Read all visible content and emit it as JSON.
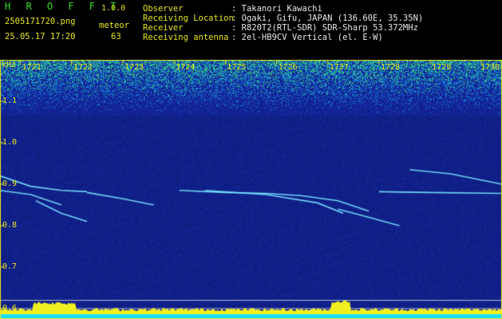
{
  "app": {
    "brand": "H R O F F T",
    "version": "1.0.0"
  },
  "file": {
    "name": "2505171720.png",
    "datetime": "25.05.17 17:20"
  },
  "meteor": {
    "label": "meteor",
    "count": "63"
  },
  "info": [
    {
      "label": "Observer",
      "value": ": Takanori Kawachi"
    },
    {
      "label": "Receiving Location",
      "value": ": Ogaki, Gifu, JAPAN (136.60E, 35.35N)"
    },
    {
      "label": "Receiver",
      "value": ": R820T2(RTL-SDR) SDR-Sharp 53.372MHz"
    },
    {
      "label": "Receiving antenna",
      "value": ": 2el-HB9CV Vertical (el. E-W)"
    }
  ],
  "colors": {
    "brand": "#35e21f",
    "accent": "#e6e619",
    "background": "#000000",
    "spectrum_low": "#0a1a8c"
  },
  "chart_data": {
    "type": "heatmap",
    "ylabel": "kHz",
    "x_ticks": [
      "1721",
      "1722",
      "1723",
      "1724",
      "1725",
      "1726",
      "1727",
      "1728",
      "1729",
      "1730"
    ],
    "y_ticks": [
      "1.1",
      "1.0",
      "0.9",
      "0.8",
      "0.7",
      "0.6"
    ],
    "xlim": [
      1720.6,
      1730.4
    ],
    "ylim": [
      0.575,
      1.2
    ],
    "reference_lines_khz": [
      0.62,
      0.6
    ],
    "echo_traces": [
      {
        "x": [
          1720.6,
          1721.2,
          1721.8,
          1722.3
        ],
        "y": [
          0.92,
          0.895,
          0.885,
          0.882
        ]
      },
      {
        "x": [
          1720.6,
          1721.2,
          1721.8
        ],
        "y": [
          0.885,
          0.875,
          0.85
        ]
      },
      {
        "x": [
          1721.3,
          1721.8,
          1722.3
        ],
        "y": [
          0.86,
          0.83,
          0.81
        ]
      },
      {
        "x": [
          1722.3,
          1723.0,
          1723.6
        ],
        "y": [
          0.88,
          0.865,
          0.85
        ]
      },
      {
        "x": [
          1724.1,
          1725.0,
          1725.8,
          1726.5,
          1727.2,
          1727.8
        ],
        "y": [
          0.885,
          0.88,
          0.878,
          0.872,
          0.86,
          0.835
        ]
      },
      {
        "x": [
          1724.6,
          1725.8,
          1726.8,
          1727.3
        ],
        "y": [
          0.885,
          0.875,
          0.855,
          0.83
        ]
      },
      {
        "x": [
          1727.2,
          1727.8,
          1728.4
        ],
        "y": [
          0.84,
          0.82,
          0.8
        ]
      },
      {
        "x": [
          1728.6,
          1729.4,
          1730.4
        ],
        "y": [
          0.935,
          0.925,
          0.9
        ]
      },
      {
        "x": [
          1728.0,
          1729.0,
          1730.4
        ],
        "y": [
          0.882,
          0.88,
          0.878
        ]
      }
    ]
  }
}
